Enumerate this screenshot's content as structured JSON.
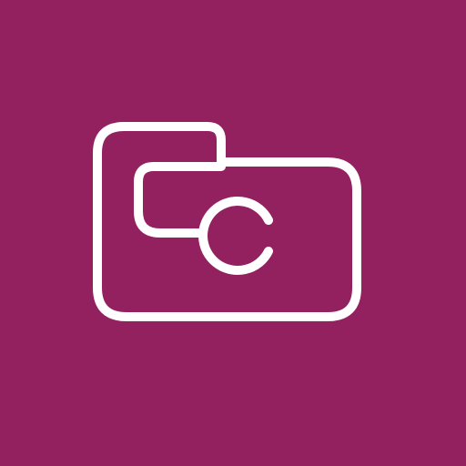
{
  "app_icon": {
    "icon": "folder-with-c-icon",
    "background_color": "#93205F",
    "stroke_color": "#FFFFFF"
  }
}
